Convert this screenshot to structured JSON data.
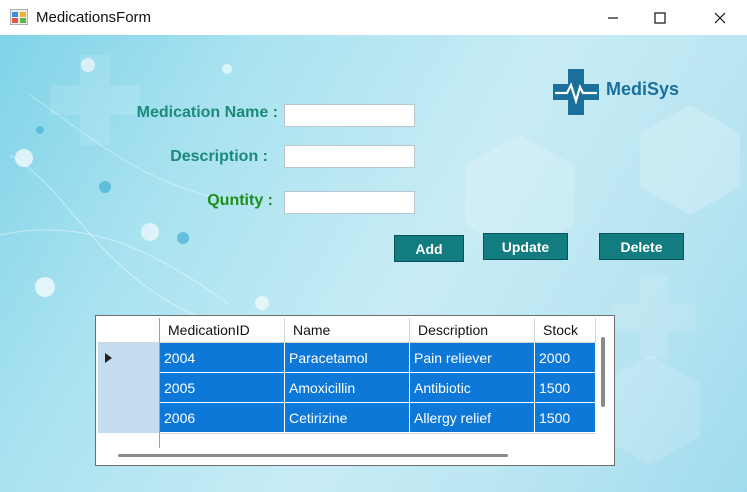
{
  "window": {
    "title": "MedicationsForm"
  },
  "form": {
    "name_label": "Medication Name :",
    "description_label": "Description :",
    "quantity_label": "Quntity :",
    "name_value": "",
    "description_value": "",
    "quantity_value": ""
  },
  "buttons": {
    "add": "Add",
    "update": "Update",
    "delete": "Delete"
  },
  "logo": {
    "text": "MediSys"
  },
  "grid": {
    "columns": [
      "MedicationID",
      "Name",
      "Description",
      "Stock"
    ],
    "rows": [
      [
        "2004",
        "Paracetamol",
        "Pain reliever",
        "2000"
      ],
      [
        "2005",
        "Amoxicillin",
        "Antibiotic",
        "1500"
      ],
      [
        "2006",
        "Cetirizine",
        "Allergy relief",
        "1500"
      ]
    ]
  },
  "colors": {
    "accent": "#137c80",
    "selection": "#0d78d8",
    "label": "#1b8a78"
  }
}
